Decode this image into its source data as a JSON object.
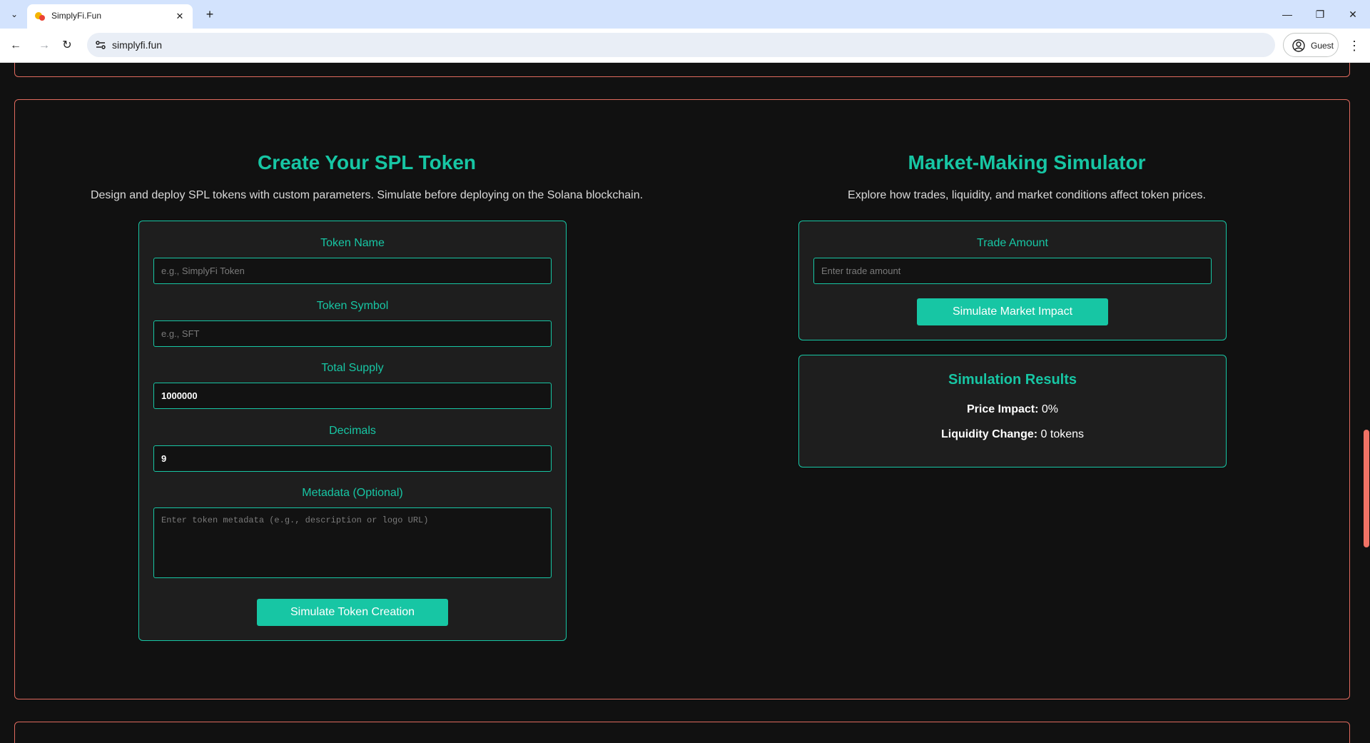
{
  "browser": {
    "tab_title": "SimplyFi.Fun",
    "url": "simplyfi.fun",
    "profile_label": "Guest"
  },
  "token_creator": {
    "title": "Create Your SPL Token",
    "description": "Design and deploy SPL tokens with custom parameters. Simulate before deploying on the Solana blockchain.",
    "fields": [
      {
        "label": "Token Name",
        "placeholder": "e.g., SimplyFi Token",
        "value": ""
      },
      {
        "label": "Token Symbol",
        "placeholder": "e.g., SFT",
        "value": ""
      },
      {
        "label": "Total Supply",
        "placeholder": "",
        "value": "1000000"
      },
      {
        "label": "Decimals",
        "placeholder": "",
        "value": "9"
      }
    ],
    "metadata": {
      "label": "Metadata (Optional)",
      "placeholder": "Enter token metadata (e.g., description or logo URL)"
    },
    "submit_label": "Simulate Token Creation"
  },
  "market_simulator": {
    "title": "Market-Making Simulator",
    "description": "Explore how trades, liquidity, and market conditions affect token prices.",
    "trade_amount_label": "Trade Amount",
    "trade_amount_placeholder": "Enter trade amount",
    "submit_label": "Simulate Market Impact",
    "results": {
      "title": "Simulation Results",
      "price_impact_label": "Price Impact:",
      "price_impact_value": "0%",
      "liquidity_change_label": "Liquidity Change:",
      "liquidity_change_value": "0 tokens"
    }
  },
  "colors": {
    "accent": "#17c6a4",
    "section_border": "#e06a5e",
    "background": "#111111",
    "card_background": "#1e1e1e"
  }
}
